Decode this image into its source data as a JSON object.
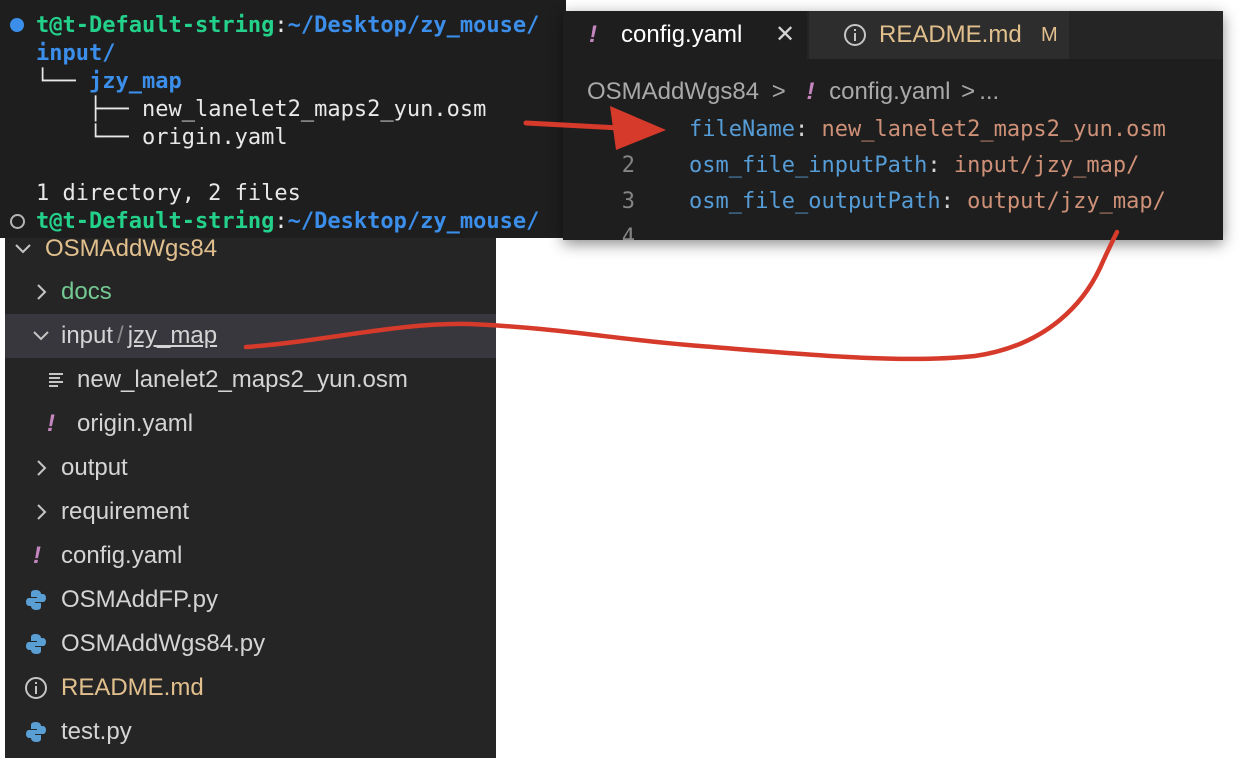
{
  "terminal": {
    "prompt_user": "t@t-Default-string",
    "prompt_colon": ":",
    "prompt_path": "~/Desktop/zy_mouse/",
    "tree": [
      {
        "prefix": "",
        "name": "input/"
      },
      {
        "prefix": "└── ",
        "name": "jzy_map"
      },
      {
        "prefix": "    ├── ",
        "name": "new_lanelet2_maps2_yun.osm"
      },
      {
        "prefix": "    └── ",
        "name": "origin.yaml"
      }
    ],
    "summary": "1 directory, 2 files",
    "colors": {
      "dot_active": "#3b8eea",
      "dot_idle": "#b5b5b5",
      "user": "#23d18b",
      "path": "#3b8eea"
    }
  },
  "explorer": {
    "root_label": "OSMAddWgs84",
    "items": [
      {
        "label": "docs",
        "icon": "chevron-right-icon"
      },
      {
        "label_part1": "input",
        "label_sep": "/",
        "label_part2": "jzy_map",
        "icon": "chevron-down-icon"
      },
      {
        "label": "new_lanelet2_maps2_yun.osm",
        "icon": "text-file-icon"
      },
      {
        "label": "origin.yaml",
        "icon": "yaml-icon",
        "icon_glyph": "!"
      },
      {
        "label": "output",
        "icon": "chevron-right-icon"
      },
      {
        "label": "requirement",
        "icon": "chevron-right-icon"
      },
      {
        "label": "config.yaml",
        "icon": "yaml-icon",
        "icon_glyph": "!"
      },
      {
        "label": "OSMAddFP.py",
        "icon": "python-icon"
      },
      {
        "label": "OSMAddWgs84.py",
        "icon": "python-icon"
      },
      {
        "label": "README.md",
        "icon": "info-icon"
      },
      {
        "label": "test.py",
        "icon": "python-icon"
      }
    ],
    "colors": {
      "folder_docs": "#73c991",
      "modified": "#e2c08d",
      "yaml": "#c586c0"
    }
  },
  "editor": {
    "tabs": [
      {
        "icon_glyph": "!",
        "label": "config.yaml",
        "close": "✕",
        "active": true
      },
      {
        "label": "README.md",
        "badge": "M",
        "active": false
      }
    ],
    "breadcrumb": {
      "folder": "OSMAddWgs84",
      "sep": ">",
      "icon_glyph": "!",
      "file": "config.yaml",
      "more": "..."
    },
    "lines": [
      {
        "num": "1",
        "key": "fileName",
        "value": "new_lanelet2_maps2_yun.osm"
      },
      {
        "num": "2",
        "key": "osm_file_inputPath",
        "value": "input/jzy_map/"
      },
      {
        "num": "3",
        "key": "osm_file_outputPath",
        "value": "output/jzy_map/"
      },
      {
        "num": "4",
        "key": "",
        "value": ""
      }
    ]
  },
  "annotations": {
    "arrow_color": "#d63a2a"
  }
}
